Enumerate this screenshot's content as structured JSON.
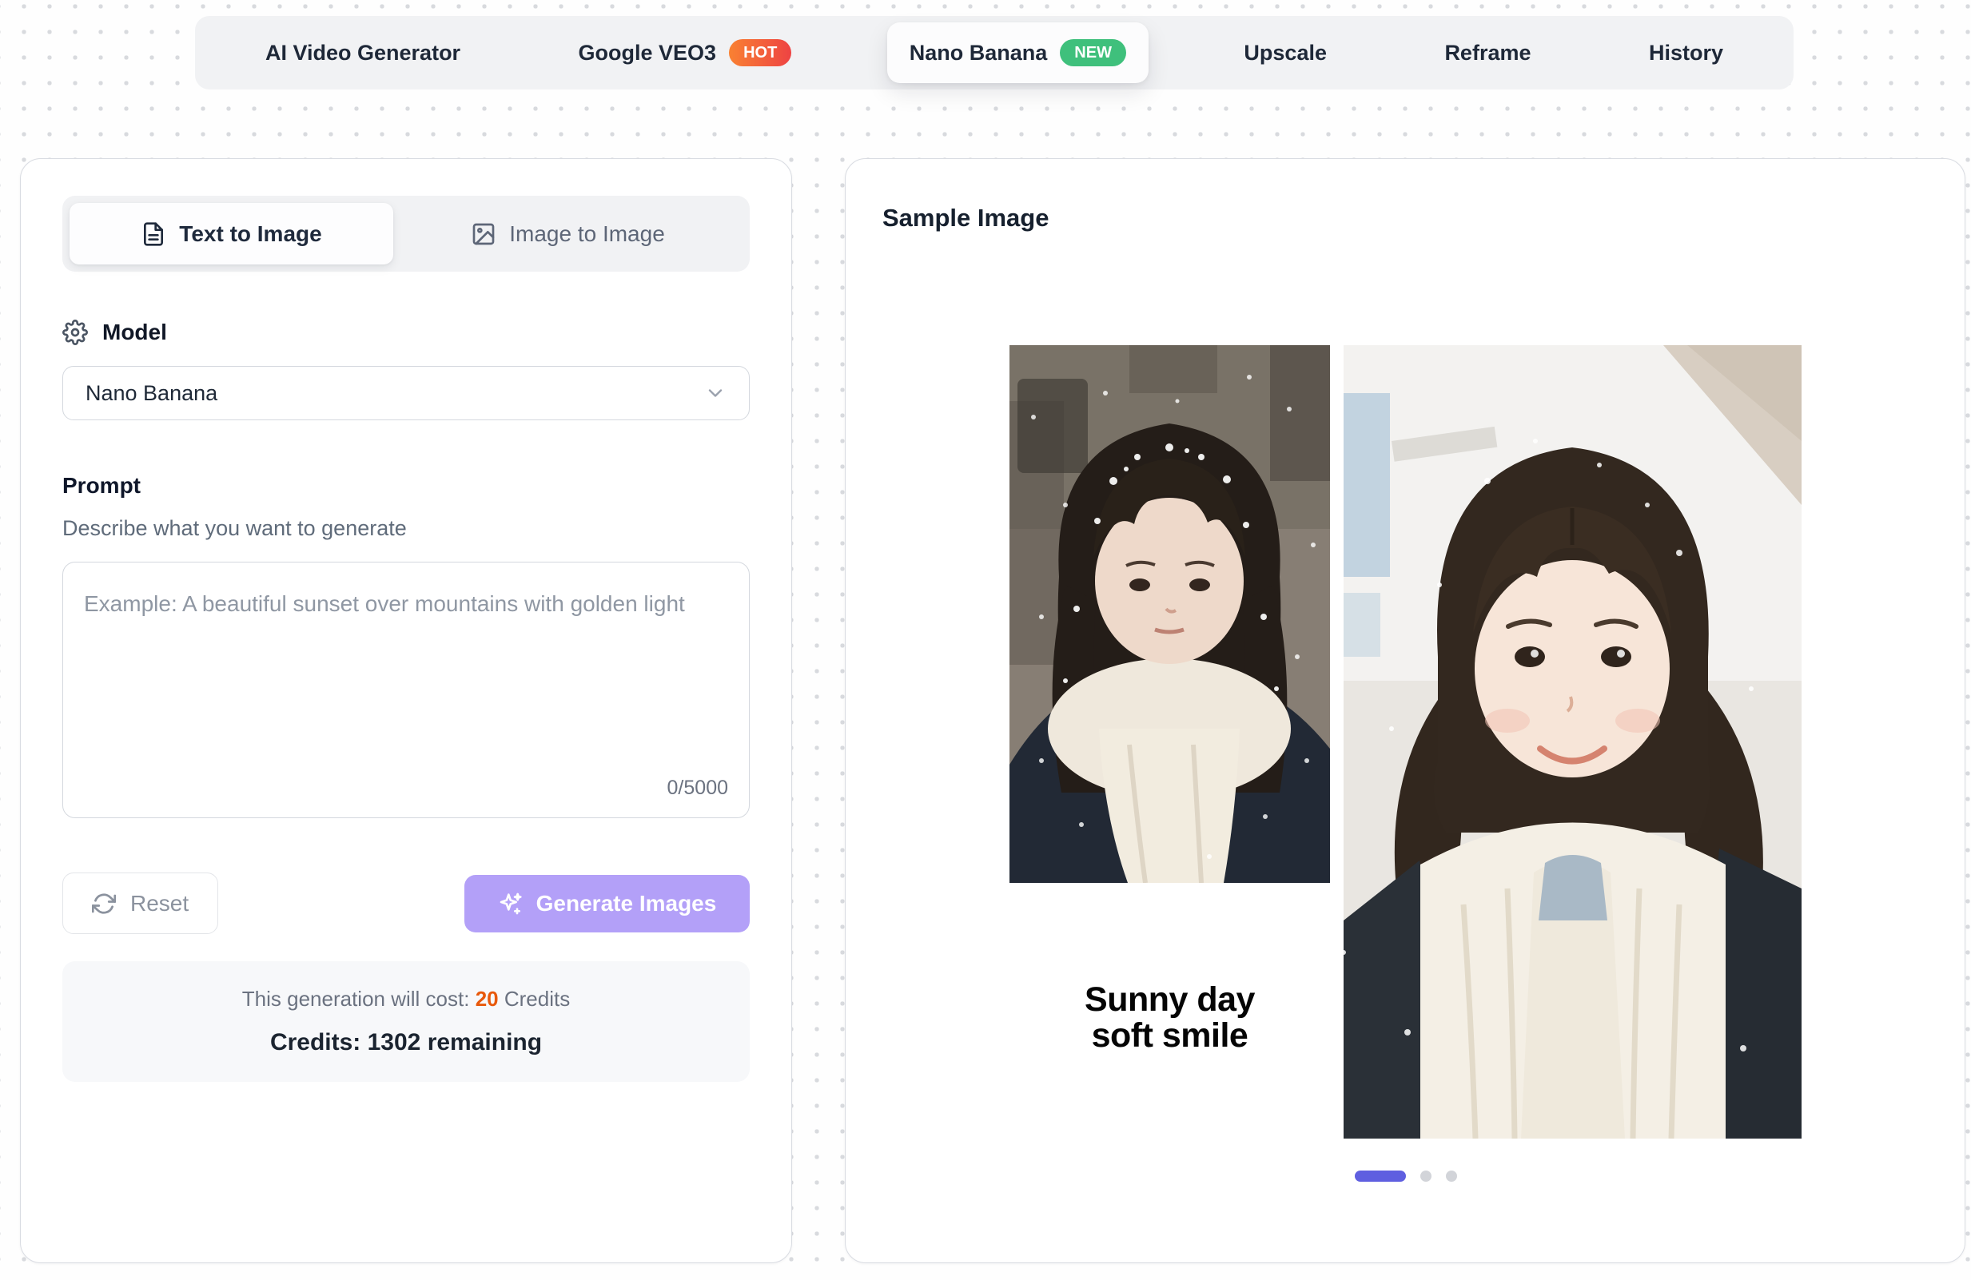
{
  "nav": {
    "items": [
      {
        "label": "AI Video Generator"
      },
      {
        "label": "Google VEO3",
        "badge": "HOT"
      },
      {
        "label": "Nano Banana",
        "badge": "NEW"
      },
      {
        "label": "Upscale"
      },
      {
        "label": "Reframe"
      },
      {
        "label": "History"
      }
    ]
  },
  "panel": {
    "tabs": [
      {
        "label": "Text to Image"
      },
      {
        "label": "Image to Image"
      }
    ],
    "model": {
      "label": "Model",
      "selected": "Nano Banana"
    },
    "prompt": {
      "label": "Prompt",
      "description": "Describe what you want to generate",
      "placeholder": "Example: A beautiful sunset over mountains with golden light",
      "counter": "0/5000"
    },
    "reset_label": "Reset",
    "generate_label": "Generate Images",
    "cost": {
      "prefix": "This generation will cost:",
      "amount": "20",
      "suffix": "Credits"
    },
    "credits": "Credits: 1302 remaining"
  },
  "sample": {
    "title": "Sample Image",
    "caption": {
      "line1": "Sunny day",
      "line2": "soft smile"
    },
    "images": {
      "before_alt": "Girl with snow-covered hair and white scarf standing in falling snow",
      "after_alt": "Smiling girl with pigtails and white scarf on a bright sunny day"
    }
  },
  "colors": {
    "accent_purple": "#b3a0f8",
    "active_dot": "#5f5fe0",
    "hot_badge": "#ee4343",
    "new_badge": "#3fc07c",
    "cost_amount_orange": "#e8590c"
  }
}
